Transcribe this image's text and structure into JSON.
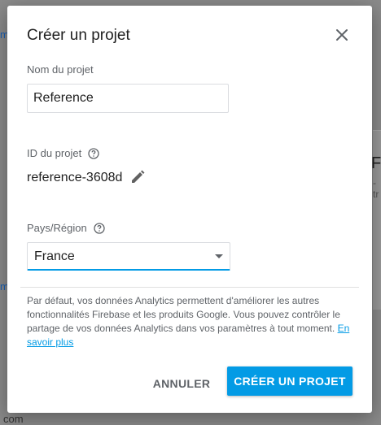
{
  "background": {
    "link_top": "m",
    "link_mid": "m",
    "domain_fragment": "com",
    "right_title_fragment": "FI",
    "right_sub_fragment": "-tr"
  },
  "dialog": {
    "title": "Créer un projet",
    "close_icon": "close-icon",
    "project_name": {
      "label": "Nom du projet",
      "value": "Reference"
    },
    "project_id": {
      "label": "ID du projet",
      "value": "reference-3608d",
      "help_icon": "help-circle-icon",
      "edit_icon": "pencil-icon"
    },
    "region": {
      "label": "Pays/Région",
      "help_icon": "help-circle-icon",
      "selected": "France"
    },
    "note_text": "Par défaut, vos données Analytics permettent d'améliorer les autres fonctionnalités Firebase et les produits Google. Vous pouvez contrôler le partage de vos données Analytics dans vos paramètres à tout moment. ",
    "note_link": "En savoir plus",
    "cancel_label": "ANNULER",
    "create_label": "CRÉER UN PROJET",
    "accent_color": "#039be5"
  }
}
